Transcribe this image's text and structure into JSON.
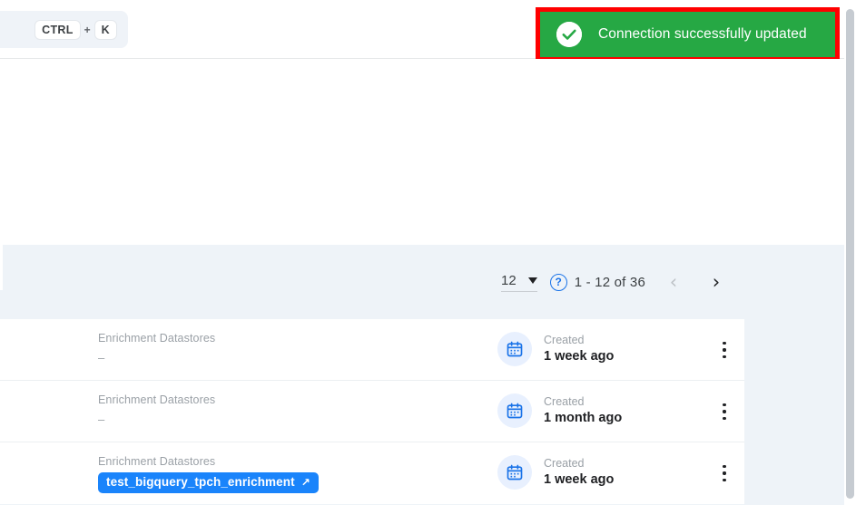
{
  "header": {
    "search": {
      "key_primary": "CTRL",
      "key_plus": "+",
      "key_secondary": "K"
    }
  },
  "toast": {
    "message": "Connection successfully updated",
    "icon": "check-circle-icon",
    "background_color": "#26a844",
    "highlight_border_color": "#ff0000",
    "text_color": "#ffffff"
  },
  "pagination": {
    "page_size": "12",
    "help_icon_label": "?",
    "range": "1 - 12 of 36",
    "prev_label": "‹",
    "next_label": "›"
  },
  "rows": [
    {
      "meta_label": "Enrichment Datastores",
      "meta_value": "–",
      "meta_value_type": "text",
      "created_label": "Created",
      "created_value": "1 week ago",
      "calendar_icon": "calendar-icon",
      "menu_icon": "kebab-menu-icon"
    },
    {
      "meta_label": "Enrichment Datastores",
      "meta_value": "–",
      "meta_value_type": "text",
      "created_label": "Created",
      "created_value": "1 month ago",
      "calendar_icon": "calendar-icon",
      "menu_icon": "kebab-menu-icon"
    },
    {
      "meta_label": "Enrichment Datastores",
      "meta_value": "test_bigquery_tpch_enrichment",
      "meta_value_type": "chip",
      "chip_external_icon": "↗",
      "chip_color": "#1a84fb",
      "created_label": "Created",
      "created_value": "1 week ago",
      "calendar_icon": "calendar-icon",
      "menu_icon": "kebab-menu-icon"
    }
  ],
  "colors": {
    "page_background": "#eef3f8",
    "accent_blue": "#1a73e8",
    "card_background": "#ffffff"
  }
}
